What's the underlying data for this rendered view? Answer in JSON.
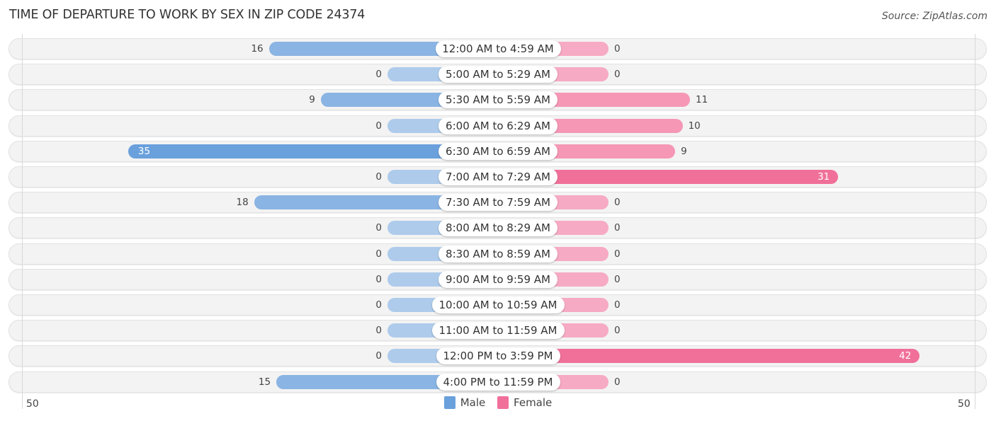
{
  "header": {
    "title": "TIME OF DEPARTURE TO WORK BY SEX IN ZIP CODE 24374",
    "source": "Source: ZipAtlas.com"
  },
  "colors": {
    "male": "#8ab4e3",
    "male_strong": "#6aa0dc",
    "female": "#f597b5",
    "female_strong": "#f0709a"
  },
  "chart_data": {
    "type": "bar",
    "orientation": "horizontal-diverging",
    "title": "TIME OF DEPARTURE TO WORK BY SEX IN ZIP CODE 24374",
    "categories": [
      "12:00 AM to 4:59 AM",
      "5:00 AM to 5:29 AM",
      "5:30 AM to 5:59 AM",
      "6:00 AM to 6:29 AM",
      "6:30 AM to 6:59 AM",
      "7:00 AM to 7:29 AM",
      "7:30 AM to 7:59 AM",
      "8:00 AM to 8:29 AM",
      "8:30 AM to 8:59 AM",
      "9:00 AM to 9:59 AM",
      "10:00 AM to 10:59 AM",
      "11:00 AM to 11:59 AM",
      "12:00 PM to 3:59 PM",
      "4:00 PM to 11:59 PM"
    ],
    "series": [
      {
        "name": "Male",
        "values": [
          16,
          0,
          9,
          0,
          35,
          0,
          18,
          0,
          0,
          0,
          0,
          0,
          0,
          15
        ]
      },
      {
        "name": "Female",
        "values": [
          0,
          0,
          11,
          10,
          9,
          31,
          0,
          0,
          0,
          0,
          0,
          0,
          42,
          0
        ]
      }
    ],
    "xlim": [
      50,
      50
    ],
    "axis_ticks": {
      "left": "50",
      "right": "50"
    },
    "legend": {
      "position": "bottom-center",
      "entries": [
        "Male",
        "Female"
      ]
    },
    "grid": false
  }
}
